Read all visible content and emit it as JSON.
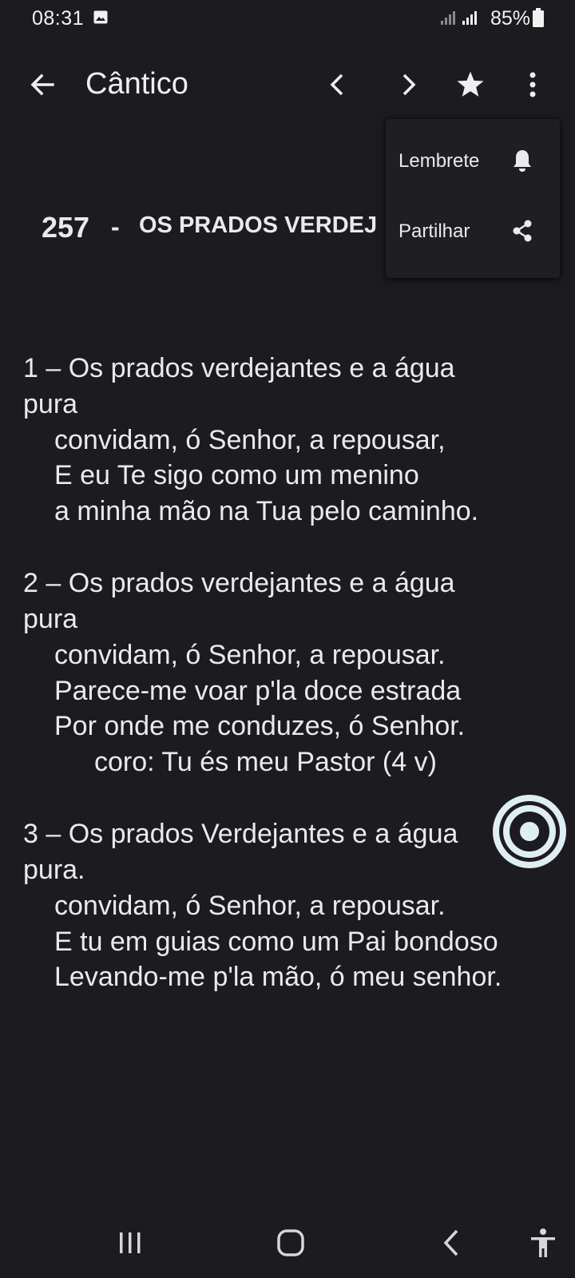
{
  "status_bar": {
    "time": "08:31",
    "battery": "85%",
    "icons": [
      "gallery-icon",
      "signal-icon",
      "signal-icon",
      "battery-icon"
    ]
  },
  "app_bar": {
    "title": "Cântico",
    "icons": [
      "back-arrow-icon",
      "chevron-left-icon",
      "chevron-right-icon",
      "star-icon",
      "more-vert-icon"
    ]
  },
  "song": {
    "number": "257",
    "separator": "-",
    "title": "OS PRADOS VERDEJ"
  },
  "lyrics": [
    "1 – Os prados verdejantes e a água",
    "pura",
    "convidam, ó Senhor, a repousar,",
    "E eu Te sigo como um menino",
    "a minha mão na Tua pelo caminho.",
    "2 – Os prados verdejantes e a água",
    "pura",
    "convidam, ó Senhor, a repousar.",
    "Parece-me voar p'la doce estrada",
    "Por onde me conduzes, ó Senhor.",
    "coro: Tu és meu Pastor (4 v)",
    "3 – Os prados Verdejantes e a água",
    "pura.",
    "convidam, ó Senhor, a repousar.",
    "E tu em guias como um Pai bondoso",
    "Levando-me p'la mão, ó meu senhor."
  ],
  "menu": {
    "items": [
      {
        "label": "Lembrete",
        "icon": "bell-icon"
      },
      {
        "label": "Partilhar",
        "icon": "share-icon"
      }
    ]
  },
  "nav_bar": {
    "icons": [
      "recent-apps-icon",
      "home-icon",
      "nav-back-icon",
      "accessibility-icon"
    ]
  },
  "colors": {
    "background": "#1c1b20",
    "text": "#ece9ee",
    "menu_background": "#1f1e23",
    "fab_ring": "#dfeef3"
  }
}
